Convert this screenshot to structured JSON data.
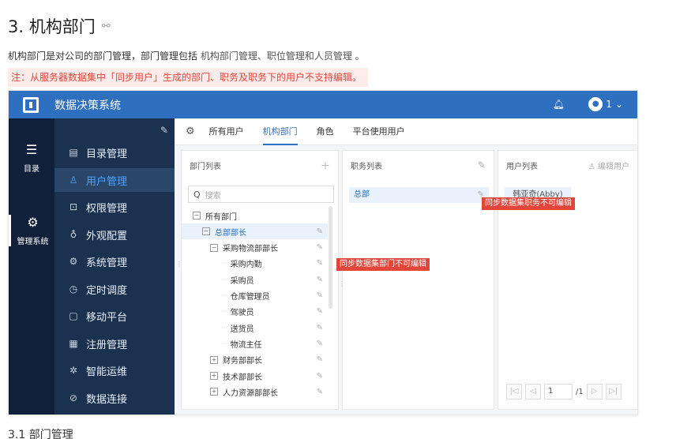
{
  "doc": {
    "heading": "3. 机构部门",
    "link_icon": "link-icon",
    "intro": "机构部门是对公司的部门管理，部门管理包括 ",
    "intro_links": "机构部门管理、职位管理和人员管理",
    "intro_end": " 。",
    "note": "注：从服务器数据集中「同步用户」生成的部门、职务及职务下的用户不支持编辑。",
    "next_heading": "3.1 部门管理"
  },
  "app": {
    "title": "数据决策系统",
    "user_label": "1",
    "rail": [
      {
        "icon": "list-icon",
        "label": "目录"
      },
      {
        "icon": "gear-icon",
        "label": "管理系统"
      }
    ],
    "menu": [
      {
        "icon": "catalog-icon",
        "label": "目录管理"
      },
      {
        "icon": "user-icon",
        "label": "用户管理",
        "active": true
      },
      {
        "icon": "lock-icon",
        "label": "权限管理"
      },
      {
        "icon": "palette-icon",
        "label": "外观配置"
      },
      {
        "icon": "gear-icon",
        "label": "系统管理"
      },
      {
        "icon": "clock-icon",
        "label": "定时调度"
      },
      {
        "icon": "mobile-icon",
        "label": "移动平台"
      },
      {
        "icon": "register-icon",
        "label": "注册管理"
      },
      {
        "icon": "ops-icon",
        "label": "智能运维"
      },
      {
        "icon": "connect-icon",
        "label": "数据连接"
      }
    ],
    "tabs": [
      "所有用户",
      "机构部门",
      "角色",
      "平台使用用户"
    ],
    "active_tab": "机构部门",
    "dept_panel": {
      "title": "部门列表",
      "search_placeholder": "搜索",
      "tree": [
        {
          "label": "所有部门",
          "level": 0,
          "toggle": "−"
        },
        {
          "label": "总部部长",
          "level": 1,
          "toggle": "−",
          "selected": true
        },
        {
          "label": "采购物流部部长",
          "level": 2,
          "toggle": "−"
        },
        {
          "label": "采购内勤",
          "level": 3
        },
        {
          "label": "采购员",
          "level": 3
        },
        {
          "label": "仓库管理员",
          "level": 3
        },
        {
          "label": "驾驶员",
          "level": 3
        },
        {
          "label": "送货员",
          "level": 3
        },
        {
          "label": "物流主任",
          "level": 3
        },
        {
          "label": "财务部部长",
          "level": 2,
          "toggle": "+"
        },
        {
          "label": "技术部部长",
          "level": 2,
          "toggle": "+"
        },
        {
          "label": "人力资源部部长",
          "level": 2,
          "toggle": "+"
        }
      ],
      "tip": "同步数据集部门不可编辑"
    },
    "pos_panel": {
      "title": "职务列表",
      "item": "总部",
      "tip": "同步数据集职务不可编辑"
    },
    "user_panel": {
      "title": "用户列表",
      "edit_label": "编辑用户",
      "user": "韩亚奇(Abby)",
      "page": "1",
      "total": "/1"
    }
  }
}
